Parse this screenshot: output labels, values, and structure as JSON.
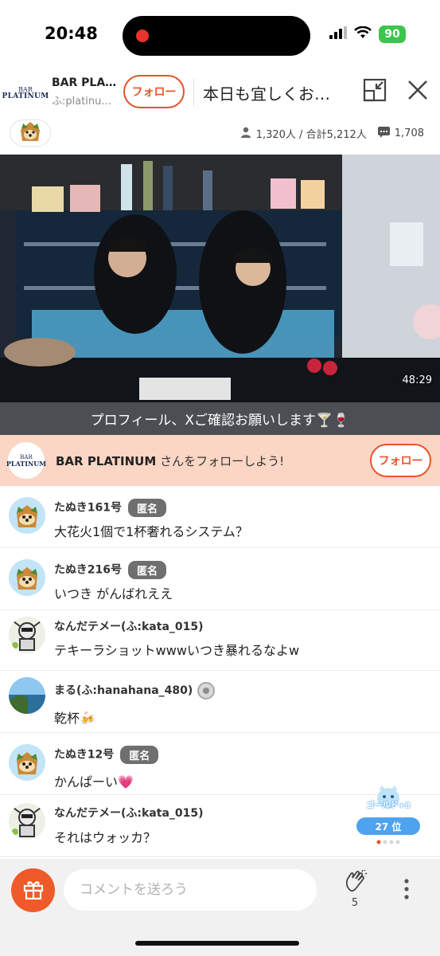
{
  "status_bar": {
    "time": "20:48",
    "battery": "90"
  },
  "header": {
    "logo_line1": "BAR",
    "logo_line2": "PLATINUM",
    "channel_name": "BAR PLA…",
    "channel_id": "ふ:platinu…",
    "follow_label": "フォロー",
    "stream_title": "本日も宜しくお…"
  },
  "stats": {
    "viewers": "1,320人 / 合計5,212人",
    "comment_count": "1,708"
  },
  "video": {
    "elapsed": "48:29",
    "caption": "プロフィール、Xご確認お願いします🍸🍷"
  },
  "follow_banner": {
    "logo_line1": "BAR",
    "logo_line2": "PLATINUM",
    "name": "BAR PLATINUM",
    "suffix": " さんをフォローしよう!",
    "follow_label": "フォロー"
  },
  "comments": [
    {
      "user": "たぬき161号",
      "badge": "匿名",
      "text": "大花火1個で1杯奢れるシステム？",
      "avatar": "tanuki-icon"
    },
    {
      "user": "たぬき216号",
      "badge": "匿名",
      "text": "いつき がんばれええ",
      "avatar": "tanuki-icon"
    },
    {
      "user": "なんだテメー(ふ:kata_015)",
      "text": "テキーラショットwwwいつき暴れるなよw",
      "avatar": "robot-icon"
    },
    {
      "user": "まる(ふ:hanahana_480)",
      "text": "乾杯🍻",
      "avatar": "sea-photo",
      "member_mark": true
    },
    {
      "user": "たぬき12号",
      "badge": "匿名",
      "text": "かんぱーい💗",
      "avatar": "tanuki-icon"
    },
    {
      "user": "なんだテメー(ふ:kata_015)",
      "text": "それはウォッカ？",
      "avatar": "robot-icon"
    }
  ],
  "rank_widget": {
    "label": "ゴールド+8",
    "rank": "27 位"
  },
  "bottom_bar": {
    "comment_placeholder": "コメントを送ろう",
    "clap_count": "5"
  },
  "colors": {
    "accent": "#e8542a",
    "banner_bg": "#fbd6c5",
    "badge_gray": "#6f6f6f",
    "rank_blue": "#4fa3ee"
  }
}
